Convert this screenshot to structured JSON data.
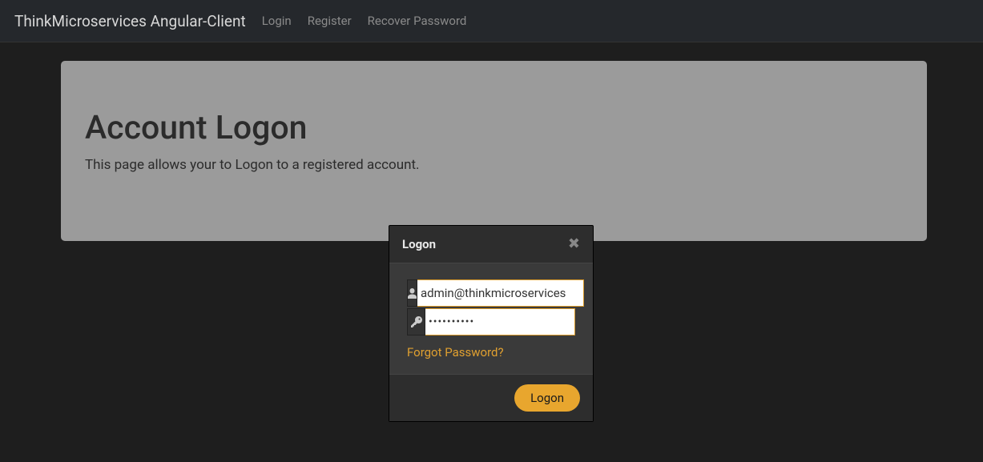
{
  "navbar": {
    "brand": "ThinkMicroservices Angular-Client",
    "links": [
      {
        "label": "Login"
      },
      {
        "label": "Register"
      },
      {
        "label": "Recover Password"
      }
    ]
  },
  "jumbotron": {
    "title": "Account Logon",
    "subtitle": "This page allows your to Logon to a registered account."
  },
  "modal": {
    "title": "Logon",
    "email_value": "admin@thinkmicroservices",
    "password_value": "••••••••••",
    "forgot_label": "Forgot Password?",
    "submit_label": "Logon"
  }
}
